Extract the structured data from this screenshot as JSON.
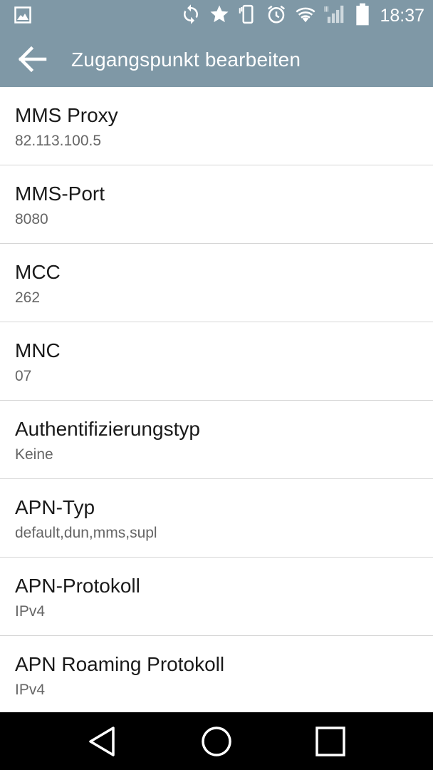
{
  "status_bar": {
    "time": "18:37",
    "icons": [
      "image-icon",
      "sync-icon",
      "star-icon",
      "vibrate-icon",
      "alarm-icon",
      "wifi-icon",
      "signal-icon",
      "battery-icon"
    ]
  },
  "app_bar": {
    "title": "Zugangspunkt bearbeiten",
    "back_icon": "arrow-back-icon"
  },
  "settings": [
    {
      "label": "MMS Proxy",
      "value": "82.113.100.5"
    },
    {
      "label": "MMS-Port",
      "value": "8080"
    },
    {
      "label": "MCC",
      "value": "262"
    },
    {
      "label": "MNC",
      "value": "07"
    },
    {
      "label": "Authentifizierungstyp",
      "value": "Keine"
    },
    {
      "label": "APN-Typ",
      "value": "default,dun,mms,supl"
    },
    {
      "label": "APN-Protokoll",
      "value": "IPv4"
    },
    {
      "label": "APN Roaming Protokoll",
      "value": "IPv4"
    }
  ],
  "nav_bar": {
    "icons": [
      "back-triangle-icon",
      "home-circle-icon",
      "recents-square-icon"
    ]
  },
  "colors": {
    "app_bar": "#7f98a6",
    "nav_bar": "#000000",
    "divider": "#d6d6d6"
  }
}
